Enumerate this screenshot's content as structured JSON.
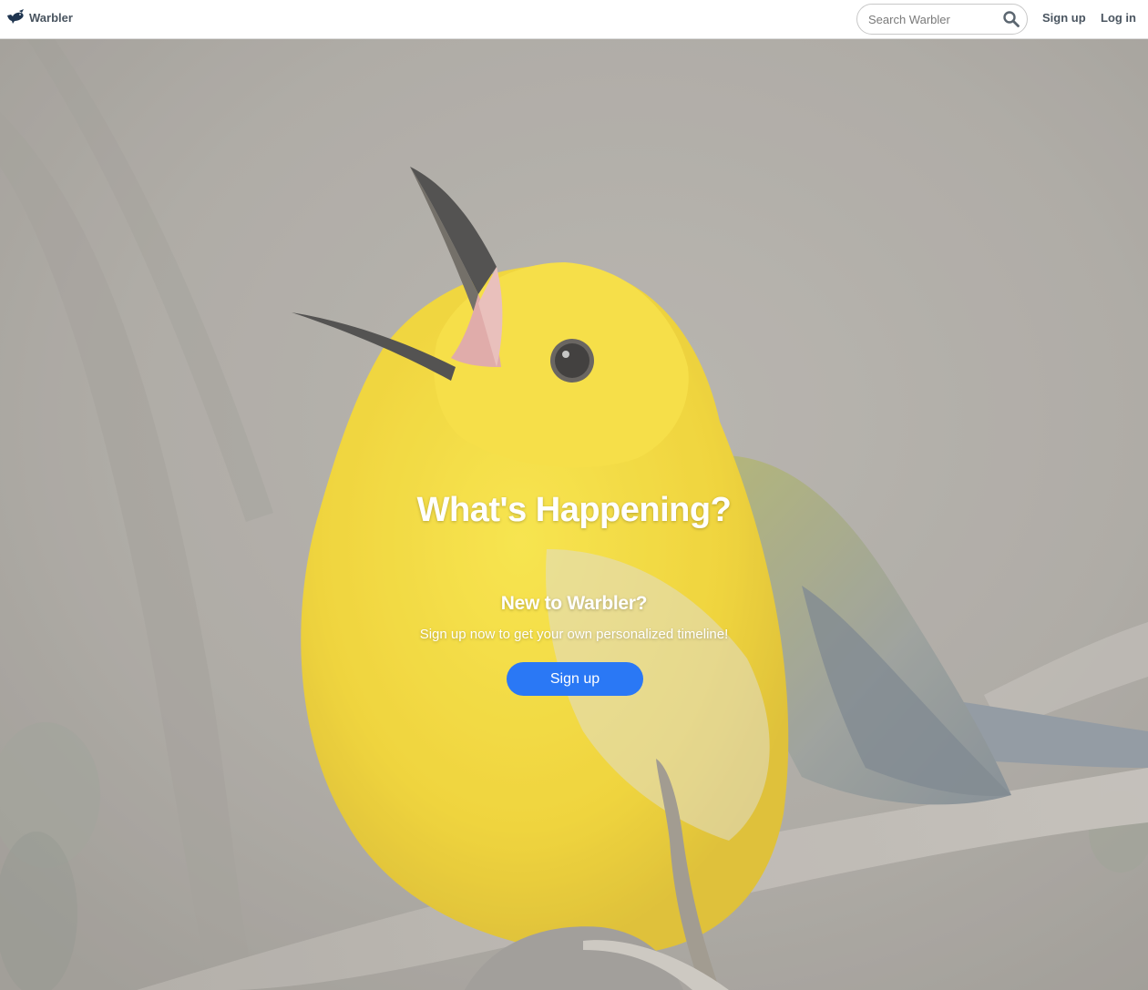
{
  "navbar": {
    "brand_name": "Warbler",
    "search_placeholder": "Search Warbler",
    "signup_label": "Sign up",
    "login_label": "Log in"
  },
  "hero": {
    "title": "What's Happening?",
    "subtitle": "New to Warbler?",
    "text": "Sign up now to get your own personalized timeline!",
    "button_label": "Sign up"
  },
  "colors": {
    "accent": "#2a78f5",
    "nav_text": "#4a5560",
    "bird_yellow": "#f2d21a"
  },
  "icons": {
    "brand": "bird-logo-icon",
    "search": "search-icon"
  }
}
